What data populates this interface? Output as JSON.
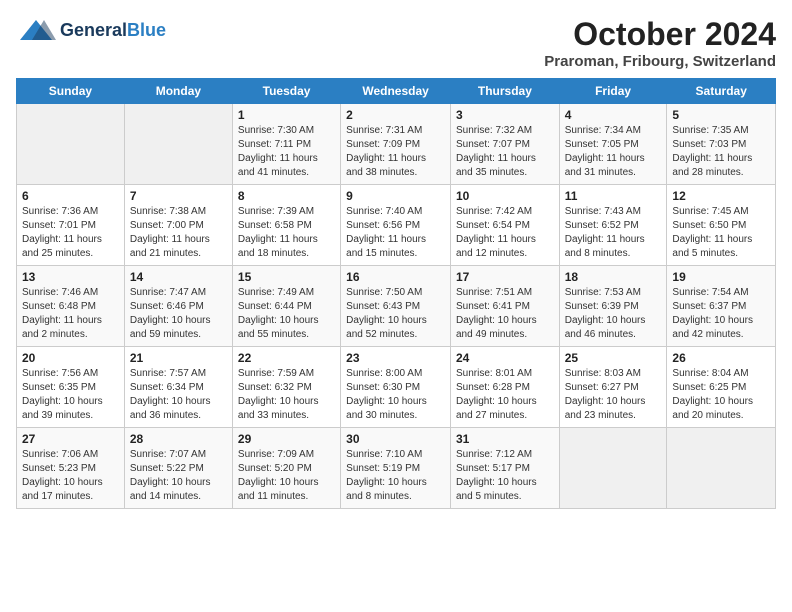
{
  "logo": {
    "general": "General",
    "blue": "Blue"
  },
  "title": "October 2024",
  "subtitle": "Praroman, Fribourg, Switzerland",
  "days_of_week": [
    "Sunday",
    "Monday",
    "Tuesday",
    "Wednesday",
    "Thursday",
    "Friday",
    "Saturday"
  ],
  "weeks": [
    [
      {
        "day": "",
        "info": ""
      },
      {
        "day": "",
        "info": ""
      },
      {
        "day": "1",
        "info": "Sunrise: 7:30 AM\nSunset: 7:11 PM\nDaylight: 11 hours and 41 minutes."
      },
      {
        "day": "2",
        "info": "Sunrise: 7:31 AM\nSunset: 7:09 PM\nDaylight: 11 hours and 38 minutes."
      },
      {
        "day": "3",
        "info": "Sunrise: 7:32 AM\nSunset: 7:07 PM\nDaylight: 11 hours and 35 minutes."
      },
      {
        "day": "4",
        "info": "Sunrise: 7:34 AM\nSunset: 7:05 PM\nDaylight: 11 hours and 31 minutes."
      },
      {
        "day": "5",
        "info": "Sunrise: 7:35 AM\nSunset: 7:03 PM\nDaylight: 11 hours and 28 minutes."
      }
    ],
    [
      {
        "day": "6",
        "info": "Sunrise: 7:36 AM\nSunset: 7:01 PM\nDaylight: 11 hours and 25 minutes."
      },
      {
        "day": "7",
        "info": "Sunrise: 7:38 AM\nSunset: 7:00 PM\nDaylight: 11 hours and 21 minutes."
      },
      {
        "day": "8",
        "info": "Sunrise: 7:39 AM\nSunset: 6:58 PM\nDaylight: 11 hours and 18 minutes."
      },
      {
        "day": "9",
        "info": "Sunrise: 7:40 AM\nSunset: 6:56 PM\nDaylight: 11 hours and 15 minutes."
      },
      {
        "day": "10",
        "info": "Sunrise: 7:42 AM\nSunset: 6:54 PM\nDaylight: 11 hours and 12 minutes."
      },
      {
        "day": "11",
        "info": "Sunrise: 7:43 AM\nSunset: 6:52 PM\nDaylight: 11 hours and 8 minutes."
      },
      {
        "day": "12",
        "info": "Sunrise: 7:45 AM\nSunset: 6:50 PM\nDaylight: 11 hours and 5 minutes."
      }
    ],
    [
      {
        "day": "13",
        "info": "Sunrise: 7:46 AM\nSunset: 6:48 PM\nDaylight: 11 hours and 2 minutes."
      },
      {
        "day": "14",
        "info": "Sunrise: 7:47 AM\nSunset: 6:46 PM\nDaylight: 10 hours and 59 minutes."
      },
      {
        "day": "15",
        "info": "Sunrise: 7:49 AM\nSunset: 6:44 PM\nDaylight: 10 hours and 55 minutes."
      },
      {
        "day": "16",
        "info": "Sunrise: 7:50 AM\nSunset: 6:43 PM\nDaylight: 10 hours and 52 minutes."
      },
      {
        "day": "17",
        "info": "Sunrise: 7:51 AM\nSunset: 6:41 PM\nDaylight: 10 hours and 49 minutes."
      },
      {
        "day": "18",
        "info": "Sunrise: 7:53 AM\nSunset: 6:39 PM\nDaylight: 10 hours and 46 minutes."
      },
      {
        "day": "19",
        "info": "Sunrise: 7:54 AM\nSunset: 6:37 PM\nDaylight: 10 hours and 42 minutes."
      }
    ],
    [
      {
        "day": "20",
        "info": "Sunrise: 7:56 AM\nSunset: 6:35 PM\nDaylight: 10 hours and 39 minutes."
      },
      {
        "day": "21",
        "info": "Sunrise: 7:57 AM\nSunset: 6:34 PM\nDaylight: 10 hours and 36 minutes."
      },
      {
        "day": "22",
        "info": "Sunrise: 7:59 AM\nSunset: 6:32 PM\nDaylight: 10 hours and 33 minutes."
      },
      {
        "day": "23",
        "info": "Sunrise: 8:00 AM\nSunset: 6:30 PM\nDaylight: 10 hours and 30 minutes."
      },
      {
        "day": "24",
        "info": "Sunrise: 8:01 AM\nSunset: 6:28 PM\nDaylight: 10 hours and 27 minutes."
      },
      {
        "day": "25",
        "info": "Sunrise: 8:03 AM\nSunset: 6:27 PM\nDaylight: 10 hours and 23 minutes."
      },
      {
        "day": "26",
        "info": "Sunrise: 8:04 AM\nSunset: 6:25 PM\nDaylight: 10 hours and 20 minutes."
      }
    ],
    [
      {
        "day": "27",
        "info": "Sunrise: 7:06 AM\nSunset: 5:23 PM\nDaylight: 10 hours and 17 minutes."
      },
      {
        "day": "28",
        "info": "Sunrise: 7:07 AM\nSunset: 5:22 PM\nDaylight: 10 hours and 14 minutes."
      },
      {
        "day": "29",
        "info": "Sunrise: 7:09 AM\nSunset: 5:20 PM\nDaylight: 10 hours and 11 minutes."
      },
      {
        "day": "30",
        "info": "Sunrise: 7:10 AM\nSunset: 5:19 PM\nDaylight: 10 hours and 8 minutes."
      },
      {
        "day": "31",
        "info": "Sunrise: 7:12 AM\nSunset: 5:17 PM\nDaylight: 10 hours and 5 minutes."
      },
      {
        "day": "",
        "info": ""
      },
      {
        "day": "",
        "info": ""
      }
    ]
  ]
}
